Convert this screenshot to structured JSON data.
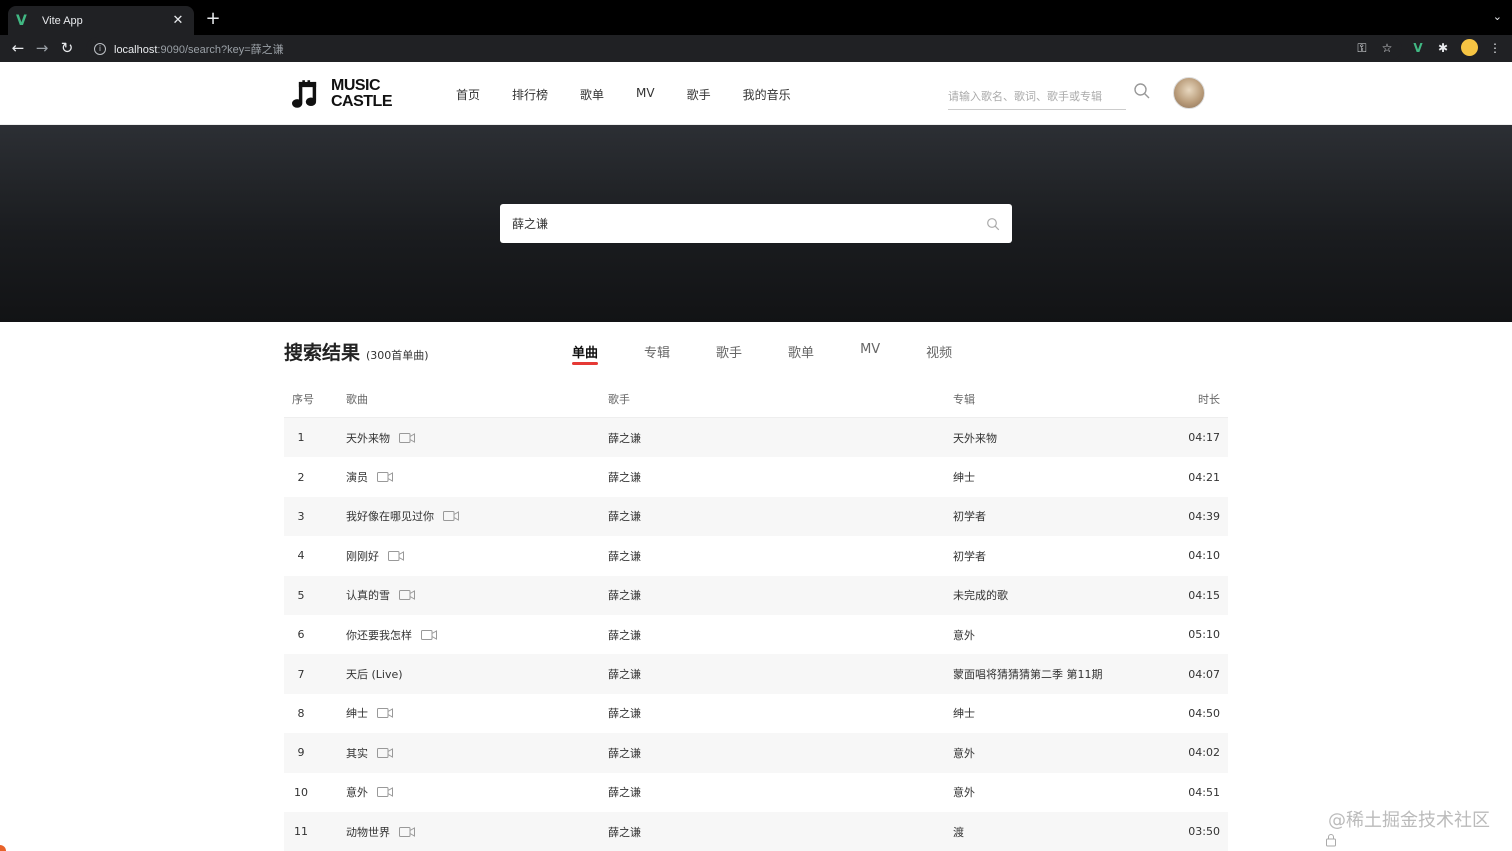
{
  "browser": {
    "tab_title": "Vite App",
    "tab_favicon": "V",
    "url_host": "localhost",
    "url_rest": ":9090/search?key=薛之谦"
  },
  "header": {
    "logo_line1": "MUSIC",
    "logo_line2": "CASTLE",
    "nav": [
      "首页",
      "排行榜",
      "歌单",
      "MV",
      "歌手",
      "我的音乐"
    ],
    "search_placeholder": "请输入歌名、歌词、歌手或专辑"
  },
  "hero": {
    "search_value": "薛之谦"
  },
  "results": {
    "title": "搜索结果",
    "count": "(300首单曲)",
    "categories": [
      "单曲",
      "专辑",
      "歌手",
      "歌单",
      "MV",
      "视频"
    ],
    "active_category": "单曲",
    "columns": [
      "序号",
      "歌曲",
      "歌手",
      "专辑",
      "时长"
    ],
    "rows": [
      {
        "idx": "1",
        "song": "天外来物",
        "mv": true,
        "artist": "薛之谦",
        "album": "天外来物",
        "duration": "04:17"
      },
      {
        "idx": "2",
        "song": "演员",
        "mv": true,
        "artist": "薛之谦",
        "album": "绅士",
        "duration": "04:21"
      },
      {
        "idx": "3",
        "song": "我好像在哪见过你",
        "mv": true,
        "artist": "薛之谦",
        "album": "初学者",
        "duration": "04:39"
      },
      {
        "idx": "4",
        "song": "刚刚好",
        "mv": true,
        "artist": "薛之谦",
        "album": "初学者",
        "duration": "04:10"
      },
      {
        "idx": "5",
        "song": "认真的雪",
        "mv": true,
        "artist": "薛之谦",
        "album": "未完成的歌",
        "duration": "04:15"
      },
      {
        "idx": "6",
        "song": "你还要我怎样",
        "mv": true,
        "artist": "薛之谦",
        "album": "意外",
        "duration": "05:10"
      },
      {
        "idx": "7",
        "song": "天后 (Live)",
        "mv": false,
        "artist": "薛之谦",
        "album": "蒙面唱将猜猜猜第二季 第11期",
        "duration": "04:07"
      },
      {
        "idx": "8",
        "song": "绅士",
        "mv": true,
        "artist": "薛之谦",
        "album": "绅士",
        "duration": "04:50"
      },
      {
        "idx": "9",
        "song": "其实",
        "mv": true,
        "artist": "薛之谦",
        "album": "意外",
        "duration": "04:02"
      },
      {
        "idx": "10",
        "song": "意外",
        "mv": true,
        "artist": "薛之谦",
        "album": "意外",
        "duration": "04:51"
      },
      {
        "idx": "11",
        "song": "动物世界",
        "mv": true,
        "artist": "薛之谦",
        "album": "渡",
        "duration": "03:50"
      }
    ]
  },
  "watermark": "@稀土掘金技术社区",
  "colors": {
    "accent": "#e53935",
    "vue_green": "#41b883"
  }
}
